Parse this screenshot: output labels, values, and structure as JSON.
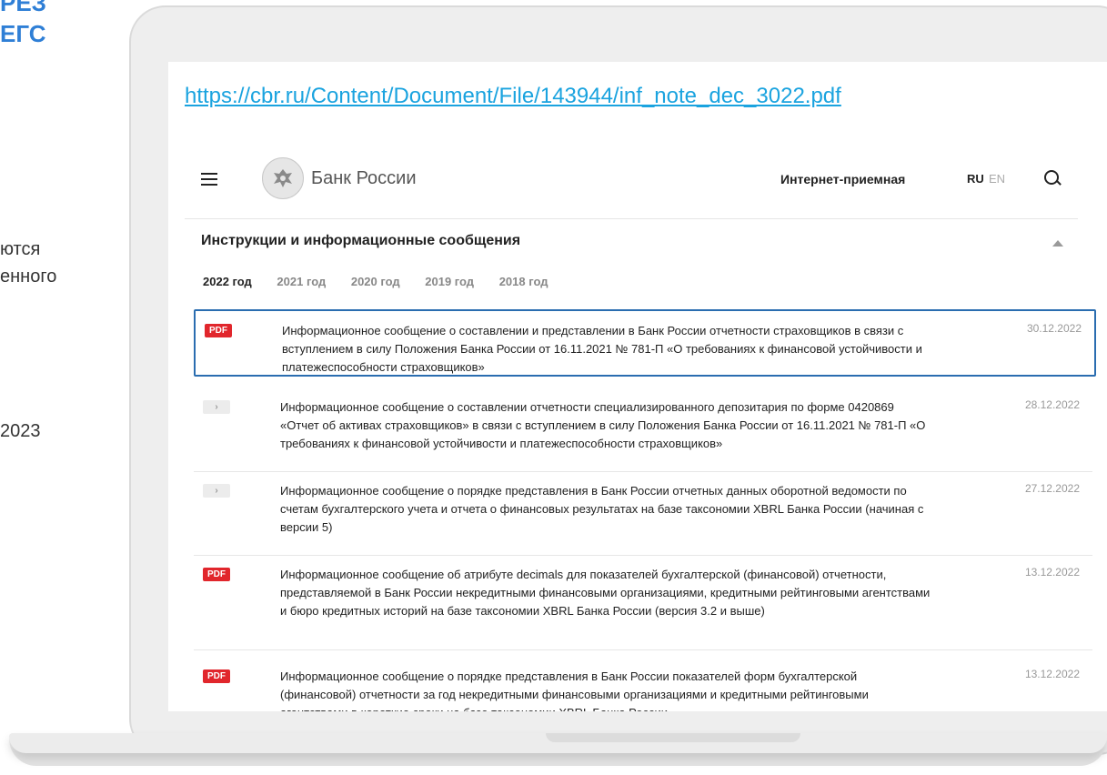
{
  "side": {
    "heading_line1": "РЕЗ",
    "heading_line2": "ЕГС",
    "text_line1": "ются",
    "text_line2": "енного",
    "text_year": "2023"
  },
  "url": "https://cbr.ru/Content/Document/File/143944/inf_note_dec_3022.pdf",
  "header": {
    "brand": "Банк России",
    "reception": "Интернет-приемная",
    "lang_ru": "RU",
    "lang_en": "EN"
  },
  "section": {
    "title": "Инструкции и информационные сообщения",
    "years": [
      "2022 год",
      "2021 год",
      "2020 год",
      "2019 год",
      "2018 год"
    ]
  },
  "items": [
    {
      "badge": "PDF",
      "text": "Информационное сообщение о составлении и представлении в Банк России отчетности страховщиков в связи с вступлением в силу Положения Банка России от 16.11.2021 № 781-П «О требованиях к финансовой устойчивости и платежеспособности страховщиков»",
      "date": "30.12.2022"
    },
    {
      "badge": "›",
      "text": "Информационное сообщение о составлении отчетности специализированного депозитария по форме 0420869 «Отчет об активах страховщиков» в связи с вступлением в силу Положения Банка России от 16.11.2021 № 781-П «О требованиях к финансовой устойчивости и платежеспособности страховщиков»",
      "date": "28.12.2022"
    },
    {
      "badge": "›",
      "text": "Информационное сообщение о порядке представления в Банк России отчетных данных оборотной ведомости по счетам бухгалтерского учета и отчета о финансовых результатах на базе таксономии XBRL Банка России (начиная с версии 5)",
      "date": "27.12.2022"
    },
    {
      "badge": "PDF",
      "text": "Информационное сообщение об атрибуте decimals для показателей бухгалтерской (финансовой) отчетности, представляемой в Банк России некредитными финансовыми организациями, кредитными рейтинговыми агентствами и бюро кредитных историй на базе таксономии XBRL Банка России (версия 3.2 и выше)",
      "date": "13.12.2022"
    },
    {
      "badge": "PDF",
      "text": "Информационное сообщение о порядке представления в Банк России показателей форм бухгалтерской (финансовой) отчетности за год некредитными финансовыми организациями и кредитными рейтинговыми агентствами в короткие сроки на базе таксономии XBRL Банка России",
      "date": "13.12.2022"
    }
  ]
}
